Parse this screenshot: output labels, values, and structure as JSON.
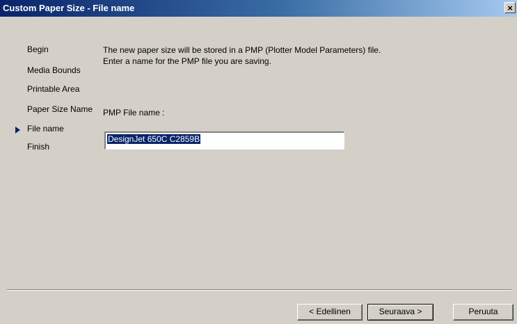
{
  "window": {
    "title": "Custom Paper Size - File name",
    "close_label": "×"
  },
  "steps": [
    {
      "label": "Begin"
    },
    {
      "label": "Media Bounds"
    },
    {
      "label": "Printable Area"
    },
    {
      "label": "Paper Size Name"
    },
    {
      "label": "File name"
    },
    {
      "label": "Finish"
    }
  ],
  "content": {
    "description": "The new paper size will be stored in a PMP (Plotter Model Parameters) file. Enter a name for the PMP file you are saving.",
    "field_label": "PMP File name :",
    "filename_value": "DesignJet 650C C2859B"
  },
  "buttons": {
    "back": "< Edellinen",
    "next": "Seuraava >",
    "cancel": "Peruuta"
  },
  "colors": {
    "title_bar": "#0a246a",
    "face": "#d4d0c8",
    "current_step_marker": "#0a246a"
  }
}
